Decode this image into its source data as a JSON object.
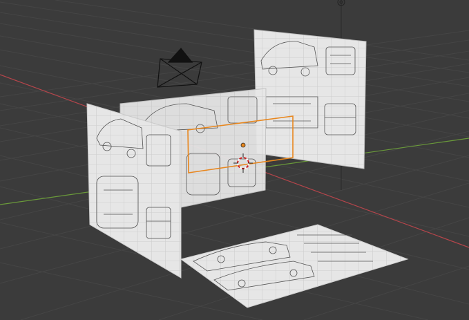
{
  "viewport": {
    "background": "#3b3b3b",
    "grid_color": "#454545",
    "x_axis_color": "#b5454b",
    "y_axis_color": "#6a9a3a",
    "z_axis_color": "#2d2d2d"
  },
  "objects": [
    {
      "name": "reference-image-front-left",
      "kind": "blueprint-plane"
    },
    {
      "name": "reference-image-front",
      "kind": "blueprint-plane"
    },
    {
      "name": "reference-image-back",
      "kind": "blueprint-plane"
    },
    {
      "name": "reference-image-floor",
      "kind": "blueprint-plane"
    },
    {
      "name": "camera",
      "kind": "camera"
    },
    {
      "name": "selected-object",
      "kind": "selection",
      "outline_color": "#e8871e"
    },
    {
      "name": "3d-cursor",
      "kind": "cursor"
    }
  ]
}
